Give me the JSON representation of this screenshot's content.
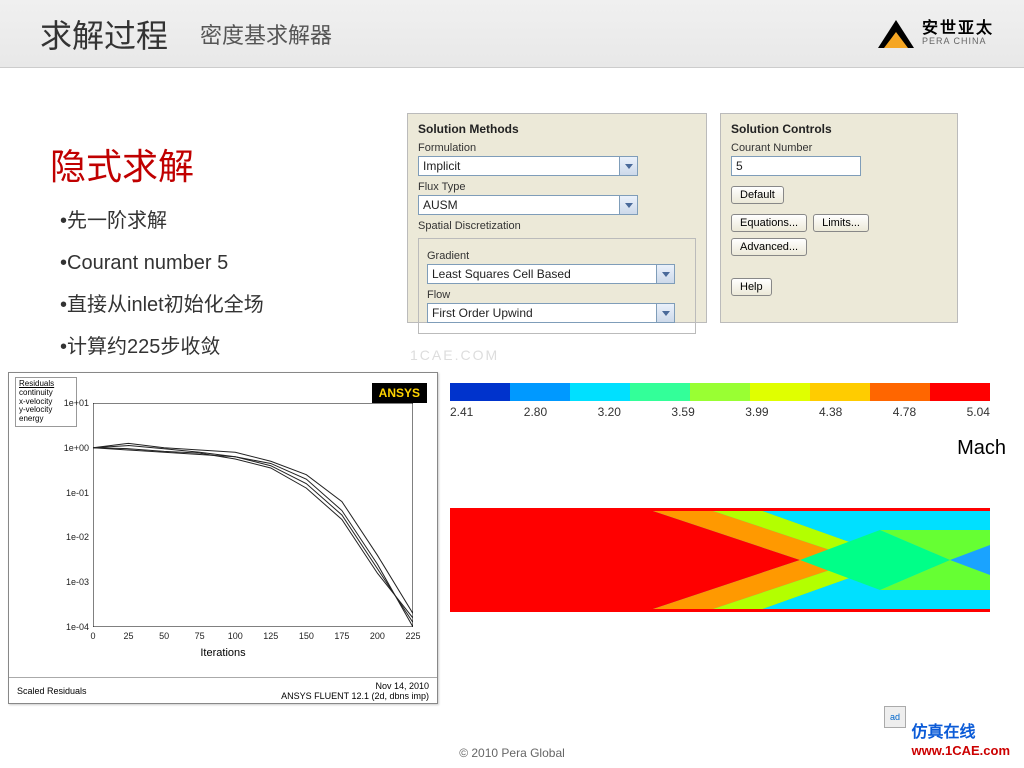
{
  "header": {
    "title_main": "求解过程",
    "title_sub": "密度基求解器",
    "logo_cn": "安世亚太",
    "logo_en": "PERA CHINA"
  },
  "section_title": "隐式求解",
  "bullets": [
    "•先一阶求解",
    "•Courant number 5",
    "•直接从inlet初始化全场",
    "•计算约225步收敛"
  ],
  "methods": {
    "panel_title": "Solution Methods",
    "formulation_label": "Formulation",
    "formulation_value": "Implicit",
    "flux_label": "Flux Type",
    "flux_value": "AUSM",
    "spatial_label": "Spatial Discretization",
    "gradient_label": "Gradient",
    "gradient_value": "Least Squares Cell Based",
    "flow_label": "Flow",
    "flow_value": "First Order Upwind"
  },
  "controls": {
    "panel_title": "Solution Controls",
    "courant_label": "Courant Number",
    "courant_value": "5",
    "btn_default": "Default",
    "btn_eq": "Equations...",
    "btn_lim": "Limits...",
    "btn_adv": "Advanced...",
    "btn_help": "Help"
  },
  "watermark": "1CAE.COM",
  "residuals": {
    "legend_title": "Residuals",
    "legend_items": [
      "continuity",
      "x-velocity",
      "y-velocity",
      "energy"
    ],
    "ansys": "ANSYS",
    "xlabel": "Iterations",
    "footer_left": "Scaled Residuals",
    "footer_date": "Nov 14, 2010",
    "footer_ver": "ANSYS FLUENT 12.1 (2d, dbns imp)"
  },
  "chart_data": {
    "type": "line",
    "xlabel": "Iterations",
    "ylabel": "",
    "yscale": "log",
    "xlim": [
      0,
      225
    ],
    "ylim_exp": [
      -4,
      1
    ],
    "x": [
      0,
      25,
      50,
      75,
      100,
      125,
      150,
      175,
      200,
      225
    ],
    "xticks": [
      0,
      25,
      50,
      75,
      100,
      125,
      150,
      175,
      200,
      225
    ],
    "yticks_exp": [
      1,
      0,
      -1,
      -2,
      -3,
      -4
    ],
    "ytick_labels": [
      "1e+01",
      "1e+00",
      "1e-01",
      "1e-02",
      "1e-03",
      "1e-04"
    ],
    "series": [
      {
        "name": "continuity",
        "values_exp": [
          0.0,
          0.1,
          0.0,
          -0.05,
          -0.1,
          -0.3,
          -0.6,
          -1.2,
          -2.4,
          -3.7
        ]
      },
      {
        "name": "x-velocity",
        "values_exp": [
          0.0,
          -0.05,
          -0.1,
          -0.15,
          -0.2,
          -0.4,
          -0.8,
          -1.5,
          -2.7,
          -3.9
        ]
      },
      {
        "name": "y-velocity",
        "values_exp": [
          0.0,
          0.05,
          -0.02,
          -0.1,
          -0.2,
          -0.35,
          -0.7,
          -1.4,
          -2.6,
          -4.0
        ]
      },
      {
        "name": "energy",
        "values_exp": [
          0.0,
          -0.02,
          -0.08,
          -0.12,
          -0.25,
          -0.45,
          -0.9,
          -1.6,
          -2.8,
          -3.8
        ]
      }
    ]
  },
  "mach": {
    "bar_values": [
      "2.41",
      "2.80",
      "3.20",
      "3.59",
      "3.99",
      "4.38",
      "4.78",
      "5.04"
    ],
    "label": "Mach",
    "colors": [
      "#0033cc",
      "#0099ff",
      "#00e0ff",
      "#33ff99",
      "#99ff33",
      "#e0ff00",
      "#ffcc00",
      "#ff6600",
      "#ff0000"
    ]
  },
  "footer": {
    "copy": "© 2010 Pera Global",
    "site_cn": "仿真在线",
    "site_url": "www.1CAE.com",
    "ad": "ad"
  }
}
